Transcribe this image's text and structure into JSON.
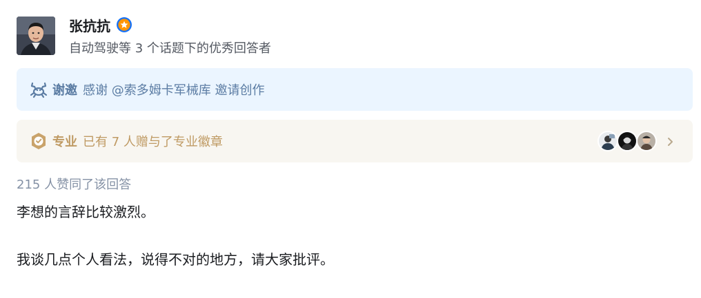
{
  "author": {
    "name": "张抗抗",
    "description": "自动驾驶等 3 个话题下的优秀回答者",
    "verified_badge_color": "#ff9607",
    "verified_ring_color": "#1772f6"
  },
  "thanks_banner": {
    "icon": "crab-icon",
    "title": "谢邀",
    "text": "感谢 @索多姆卡军械库 邀请创作"
  },
  "pro_banner": {
    "icon": "professional-badge-icon",
    "title": "专业",
    "text": "已有 7 人赠与了专业徽章",
    "avatars": [
      {
        "name": "avatar-1"
      },
      {
        "name": "avatar-2"
      },
      {
        "name": "avatar-3"
      }
    ]
  },
  "answer": {
    "vote_text": "215 人赞同了该回答",
    "paragraphs": [
      "李想的言辞比较激烈。",
      "我谈几点个人看法，说得不对的地方，请大家批评。"
    ]
  }
}
